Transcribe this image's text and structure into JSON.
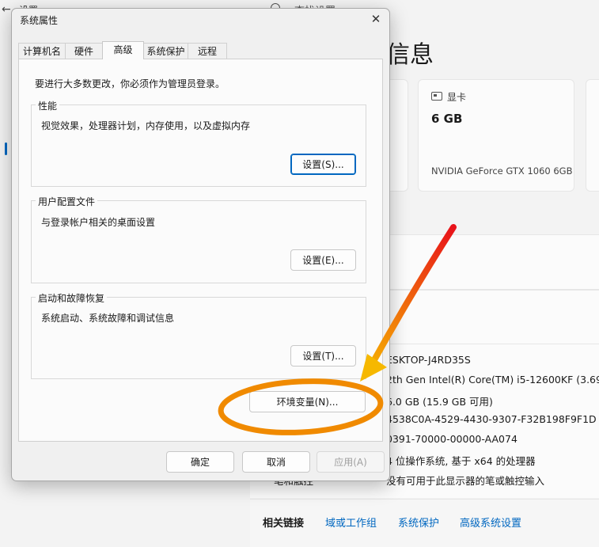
{
  "background": {
    "settings_title": "设置",
    "search_placeholder": "查找设置",
    "page_heading": "信息",
    "gpu_card": {
      "label": "显卡",
      "memory": "6 GB",
      "model": "NVIDIA GeForce GTX 1060 6GB"
    },
    "specs": {
      "device_name": "ESKTOP-J4RD35S",
      "processor": "2th Gen Intel(R) Core(TM) i5-12600KF (3.69 G",
      "ram": "6.0 GB (15.9 GB 可用)",
      "device_id": "4538C0A-4529-4430-9307-F32B198F9F1D",
      "product_id": "0391-70000-00000-AA074",
      "system_type": "4 位操作系统, 基于 x64 的处理器",
      "pen_touch_label": "笔和触控",
      "pen_touch_value": "没有可用于此显示器的笔或触控输入"
    },
    "related": {
      "title": "相关链接",
      "links": [
        "域或工作组",
        "系统保护",
        "高级系统设置"
      ]
    }
  },
  "dialog": {
    "title": "系统属性",
    "close_glyph": "✕",
    "tabs": [
      "计算机名",
      "硬件",
      "高级",
      "系统保护",
      "远程"
    ],
    "active_tab": "高级",
    "admin_note": "要进行大多数更改，你必须作为管理员登录。",
    "performance": {
      "title": "性能",
      "desc": "视觉效果，处理器计划，内存使用，以及虚拟内存",
      "button": "设置(S)..."
    },
    "user_profiles": {
      "title": "用户配置文件",
      "desc": "与登录帐户相关的桌面设置",
      "button": "设置(E)..."
    },
    "startup_recovery": {
      "title": "启动和故障恢复",
      "desc": "系统启动、系统故障和调试信息",
      "button": "设置(T)..."
    },
    "env_vars_button": "环境变量(N)...",
    "footer": {
      "ok": "确定",
      "cancel": "取消",
      "apply": "应用(A)"
    }
  },
  "annotation_colors": {
    "arrow_start": "#e8121a",
    "arrow_end": "#f6b800",
    "ellipse": "#f08a00"
  }
}
